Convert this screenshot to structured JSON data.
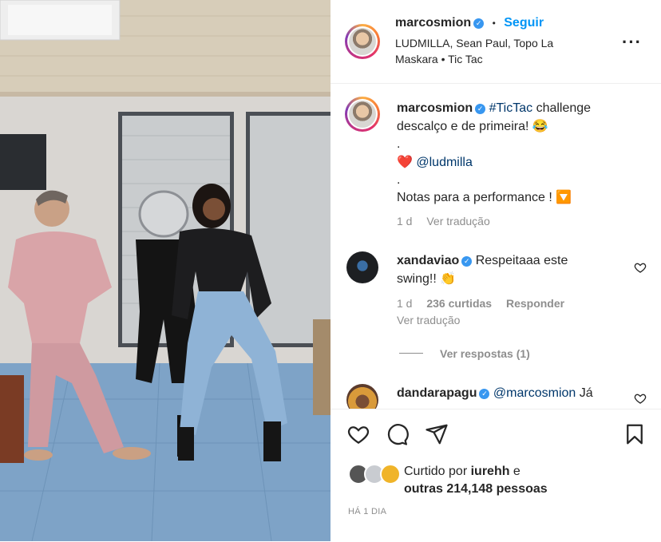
{
  "post": {
    "username": "marcosmion",
    "follow_label": "Seguir",
    "separator": "•",
    "audio_line1": "LUDMILLA, Sean Paul, Topo La",
    "audio_line2": "Maskara • Tic Tac",
    "more_icon": "more-horizontal-icon"
  },
  "caption": {
    "username": "marcosmion",
    "hashtag": "#TicTac",
    "text_line1_rest": " challenge",
    "text_line2": "descalço e de primeira! 😂",
    "dot1": ".",
    "mention": "@ludmilla",
    "heart": "❤️",
    "dot2": ".",
    "text_line5": "Notas para a performance ! 🔽",
    "age": "1 d",
    "translate": "Ver tradução"
  },
  "comments": [
    {
      "username": "xandaviao",
      "text_line1": "Respeitaaa este",
      "text_line2": "swing!! 👏",
      "age": "1 d",
      "likes": "236 curtidas",
      "reply": "Responder",
      "translate": "Ver tradução",
      "view_replies": "Ver respostas (1)"
    },
    {
      "username": "dandarapagu",
      "mention": "@marcosmion",
      "text": " Já"
    }
  ],
  "actions": {
    "liked_by_prefix": "Curtido por ",
    "liked_by_user": "iurehh",
    "liked_by_suffix": " e",
    "others": "outras 214,148 pessoas",
    "date": "HÁ 1 DIA"
  },
  "colors": {
    "accent": "#0095f6",
    "verified": "#3897f0",
    "muted": "#8e8e8e"
  }
}
